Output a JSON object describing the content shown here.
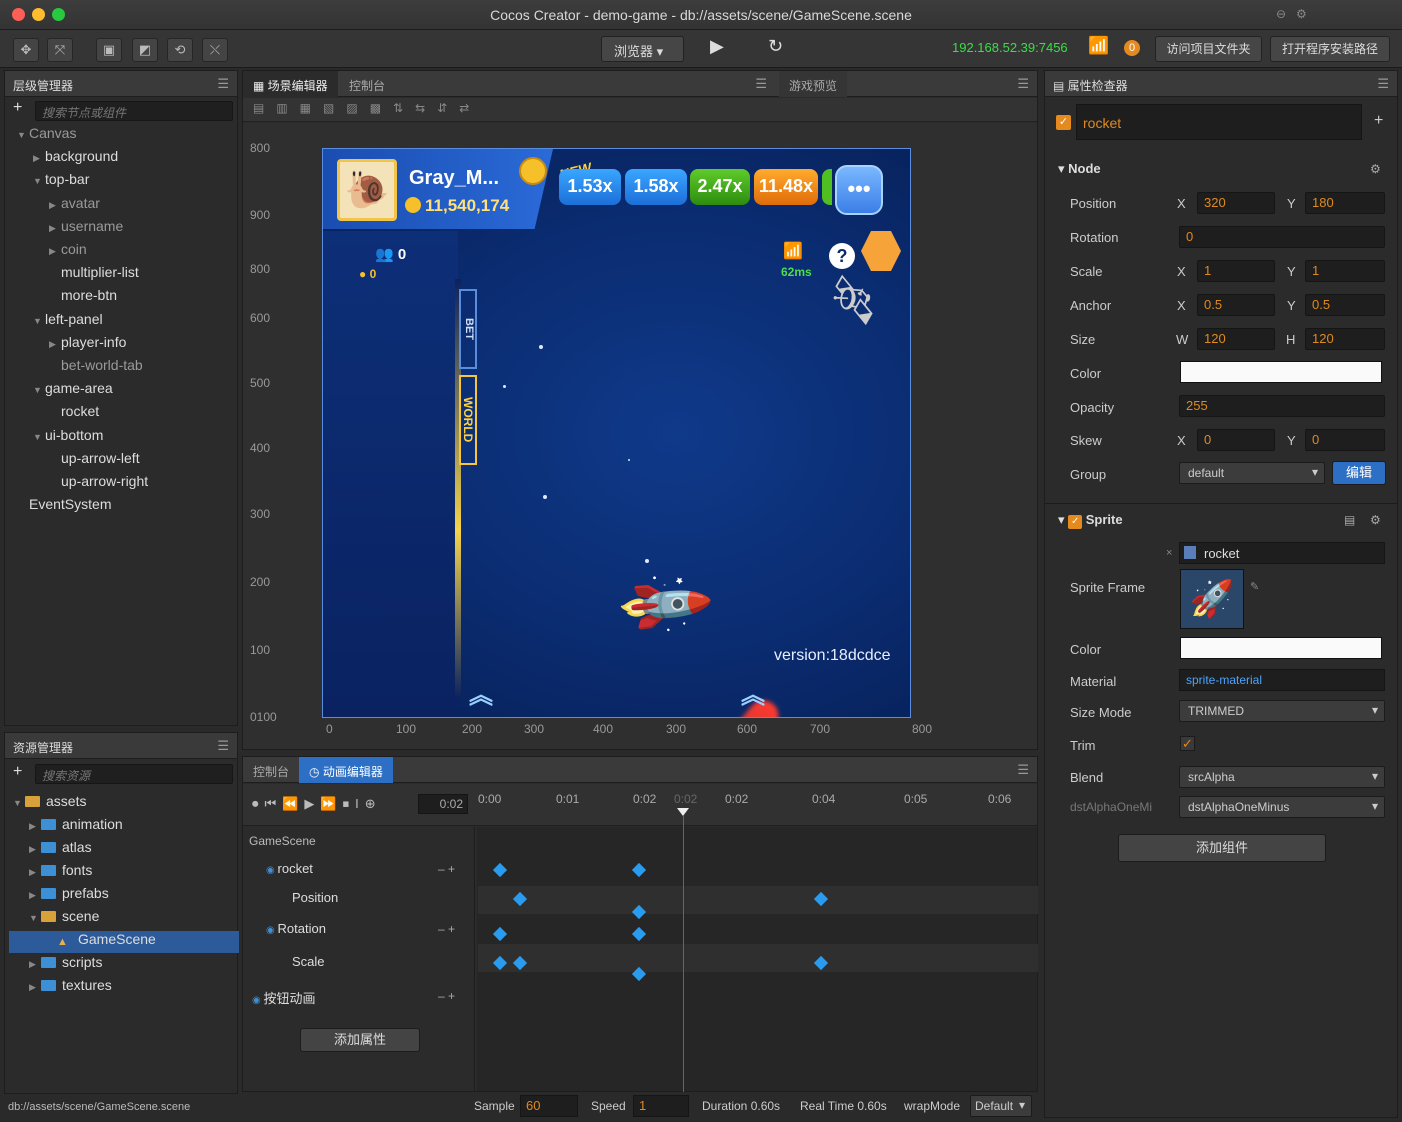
{
  "window": {
    "title": "Cocos Creator - demo-game - db://assets/scene/GameScene.scene"
  },
  "toolbar": {
    "browser_label": "浏览器",
    "ip": "192.168.52.39:7456",
    "open_project_btn": "访问项目文件夹",
    "open_install_btn": "打开程序安装路径",
    "notif_count": "0"
  },
  "hierarchy": {
    "title": "层级管理器",
    "search_placeholder": "搜索节点或组件",
    "items": [
      {
        "label": "Canvas",
        "depth": 0,
        "arrow": "▼",
        "dim": true
      },
      {
        "label": "background",
        "depth": 1,
        "arrow": "▶"
      },
      {
        "label": "top-bar",
        "depth": 1,
        "arrow": "▼"
      },
      {
        "label": "avatar",
        "depth": 2,
        "arrow": "▶",
        "dim": true
      },
      {
        "label": "username",
        "depth": 2,
        "arrow": "▶",
        "dim": true
      },
      {
        "label": "coin",
        "depth": 2,
        "arrow": "▶",
        "dim": true
      },
      {
        "label": "multiplier-list",
        "depth": 2,
        "arrow": ""
      },
      {
        "label": "more-btn",
        "depth": 2,
        "arrow": ""
      },
      {
        "label": "left-panel",
        "depth": 1,
        "arrow": "▼"
      },
      {
        "label": "player-info",
        "depth": 2,
        "arrow": "▶"
      },
      {
        "label": "bet-world-tab",
        "depth": 2,
        "arrow": "",
        "dim": true
      },
      {
        "label": "game-area",
        "depth": 1,
        "arrow": "▼"
      },
      {
        "label": "rocket",
        "depth": 2,
        "arrow": ""
      },
      {
        "label": "ui-bottom",
        "depth": 1,
        "arrow": "▼"
      },
      {
        "label": "up-arrow-left",
        "depth": 2,
        "arrow": ""
      },
      {
        "label": "up-arrow-right",
        "depth": 2,
        "arrow": ""
      },
      {
        "label": "EventSystem",
        "depth": 0,
        "arrow": ""
      }
    ]
  },
  "scene_editor": {
    "tab1": "场景编辑器",
    "tab2": "控制台",
    "tab3": "游戏预览",
    "ruler_v": [
      "800",
      "900",
      "800",
      "600",
      "500",
      "400",
      "300",
      "200",
      "100",
      "0100"
    ],
    "ruler_h": [
      "0",
      "100",
      "200",
      "300",
      "400",
      "300",
      "600",
      "700",
      "800"
    ]
  },
  "game": {
    "username": "Gray_M...",
    "coins": "11,540,174",
    "new_badge": "NEW",
    "multipliers": [
      "1.53x",
      "1.58x",
      "2.47x",
      "11.48x"
    ],
    "players": "0",
    "player_coins": "0",
    "bet_tab": "BET",
    "world_tab": "WORLD",
    "ping": "62ms",
    "version": "version:18dcdce"
  },
  "assets": {
    "title": "资源管理器",
    "search_placeholder": "搜索资源",
    "items": [
      {
        "label": "assets",
        "depth": 0,
        "arrow": "▼"
      },
      {
        "label": "animation",
        "depth": 1,
        "arrow": "▶"
      },
      {
        "label": "atlas",
        "depth": 1,
        "arrow": "▶"
      },
      {
        "label": "fonts",
        "depth": 1,
        "arrow": "▶"
      },
      {
        "label": "prefabs",
        "depth": 1,
        "arrow": "▶"
      },
      {
        "label": "scene",
        "depth": 1,
        "arrow": "▼"
      },
      {
        "label": "GameScene",
        "depth": 2,
        "arrow": "",
        "selected": true
      },
      {
        "label": "scripts",
        "depth": 1,
        "arrow": "▶"
      },
      {
        "label": "textures",
        "depth": 1,
        "arrow": "▶"
      }
    ]
  },
  "status_path": "db://assets/scene/GameScene.scene",
  "animation": {
    "tab_inactive": "控制台",
    "tab_active": "动画编辑器",
    "current_time": "0:02",
    "ruler": [
      "0:00",
      "0:01",
      "0:02",
      "0:02",
      "0:02",
      "0:04",
      "0:05",
      "0:06"
    ],
    "root": "GameScene",
    "tracks": [
      "rocket",
      "Position",
      "Rotation",
      "Scale",
      "按钮动画"
    ],
    "add_prop_btn": "添加属性",
    "sample_label": "Sample",
    "sample": "60",
    "speed_label": "Speed",
    "speed": "1",
    "duration": "Duration 0.60s",
    "realtime": "Real Time 0.60s",
    "wrap_label": "wrapMode",
    "wrap": "Default"
  },
  "inspector": {
    "title": "属性检查器",
    "node_name": "rocket",
    "node_section": "Node",
    "position_label": "Position",
    "pos_x": "320",
    "pos_y": "180",
    "rotation_label": "Rotation",
    "rotation": "0",
    "scale_label": "Scale",
    "scale_x": "1",
    "scale_y": "1",
    "anchor_label": "Anchor",
    "anchor_x": "0.5",
    "anchor_y": "0.5",
    "size_label": "Size",
    "size_w": "120",
    "size_h": "120",
    "color_label": "Color",
    "opacity_label": "Opacity",
    "opacity": "255",
    "skew_label": "Skew",
    "skew_x": "0",
    "skew_y": "0",
    "group_label": "Group",
    "group": "default",
    "edit_btn": "编辑",
    "sprite_section": "Sprite",
    "sprite_frame_label": "Sprite Frame",
    "sprite_frame": "rocket",
    "sprite_color_label": "Color",
    "material_label": "Material",
    "material": "sprite-material",
    "sizemode_label": "Size Mode",
    "sizemode": "TRIMMED",
    "trim_label": "Trim",
    "blend_label": "Blend",
    "blend_src": "srcAlpha",
    "blend_dst_label": "dstAlphaOneMi",
    "blend_dst": "dstAlphaOneMinus",
    "add_component_btn": "添加组件",
    "axis_x": "X",
    "axis_y": "Y",
    "axis_w": "W",
    "axis_h": "H"
  },
  "colors": {
    "accent": "#2a9cf0",
    "field_text": "#e08a1e",
    "ip_green": "#3ddc4a"
  }
}
